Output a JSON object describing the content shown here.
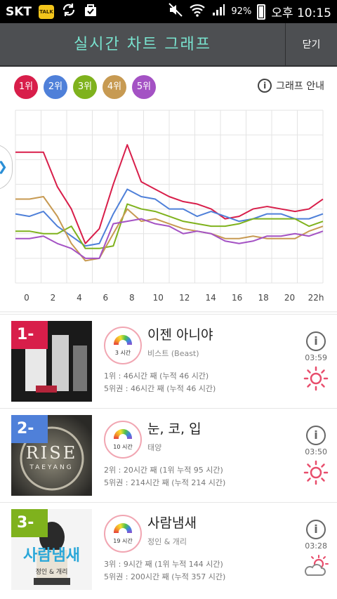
{
  "statusbar": {
    "carrier": "SKT",
    "talk": "TALK",
    "battery": "92%",
    "time": "오후 10:15"
  },
  "header": {
    "title": "실시간 차트 그래프",
    "close_label": "닫기"
  },
  "rank_buttons": [
    {
      "label": "1위",
      "color": "#d81e4a"
    },
    {
      "label": "2위",
      "color": "#4f80d9"
    },
    {
      "label": "3위",
      "color": "#7fb21d"
    },
    {
      "label": "4위",
      "color": "#c79a52"
    },
    {
      "label": "5위",
      "color": "#a452c4"
    }
  ],
  "guide_label": "그래프 안내",
  "chart_data": {
    "type": "line",
    "x": [
      0,
      1,
      2,
      3,
      4,
      5,
      6,
      7,
      8,
      9,
      10,
      11,
      12,
      13,
      14,
      15,
      16,
      17,
      18,
      19,
      20,
      21,
      22
    ],
    "tick_labels": [
      "0",
      "2",
      "4",
      "6",
      "8",
      "10",
      "12",
      "14",
      "16",
      "18",
      "20",
      "22h"
    ],
    "ylim": [
      0,
      7
    ],
    "grid": true,
    "series": [
      {
        "color": "#d81e4a",
        "values": [
          5.3,
          5.3,
          5.3,
          3.9,
          3.0,
          1.6,
          2.2,
          4.0,
          5.6,
          4.1,
          3.8,
          3.5,
          3.3,
          3.2,
          3.0,
          2.6,
          2.7,
          3.0,
          3.1,
          3.0,
          2.9,
          3.0,
          3.4
        ]
      },
      {
        "color": "#4f80d9",
        "values": [
          2.8,
          2.7,
          2.9,
          2.3,
          1.9,
          1.5,
          1.6,
          2.8,
          3.8,
          3.5,
          3.4,
          3.0,
          3.0,
          2.7,
          2.9,
          2.7,
          2.5,
          2.6,
          2.8,
          2.8,
          2.6,
          2.6,
          2.8
        ]
      },
      {
        "color": "#7fb21d",
        "values": [
          2.1,
          2.1,
          2.0,
          2.0,
          2.3,
          1.4,
          1.4,
          1.5,
          3.2,
          3.0,
          2.9,
          2.7,
          2.5,
          2.4,
          2.3,
          2.3,
          2.4,
          2.6,
          2.6,
          2.6,
          2.6,
          2.3,
          2.5
        ]
      },
      {
        "color": "#c79a52",
        "values": [
          3.4,
          3.4,
          3.5,
          2.7,
          1.6,
          0.9,
          1.0,
          2.0,
          3.0,
          2.5,
          2.6,
          2.4,
          2.2,
          2.1,
          2.0,
          1.8,
          1.8,
          1.9,
          1.8,
          1.8,
          1.8,
          2.1,
          2.3
        ]
      },
      {
        "color": "#a452c4",
        "values": [
          1.8,
          1.8,
          1.9,
          1.6,
          1.4,
          1.0,
          1.0,
          2.4,
          2.5,
          2.6,
          2.4,
          2.3,
          2.0,
          2.1,
          2.0,
          1.7,
          1.6,
          1.7,
          1.9,
          1.9,
          2.0,
          1.9,
          2.1
        ]
      }
    ]
  },
  "list": [
    {
      "rank": "1-",
      "rank_color": "#d81e4a",
      "weeks": "3 시간",
      "title": "이젠 아니야",
      "artist": "비스트 (Beast)",
      "stat1": "1위 : 46시간 째 (누적 46 시간)",
      "stat2": "5위권 : 46시간 째 (누적 46 시간)",
      "time": "03:59",
      "weather": "sun"
    },
    {
      "rank": "2-",
      "rank_color": "#4f80d9",
      "weeks": "10 시간",
      "title": "눈, 코, 입",
      "artist": "태양",
      "cover_text": "RISE",
      "cover_sub": "TAEYANG",
      "stat1": "2위 : 20시간 째 (1위 누적 95 시간)",
      "stat2": "5위권 : 214시간 째 (누적 214 시간)",
      "time": "03:50",
      "weather": "sun"
    },
    {
      "rank": "3-",
      "rank_color": "#7fb21d",
      "weeks": "19 시간",
      "title": "사람냄새",
      "artist": "정인 & 개리",
      "cover_text": "사람냄새",
      "cover_sub": "정인 & 개리",
      "stat1": "3위 : 9시간 째 (1위 누적 144 시간)",
      "stat2": "5위권 : 200시간 째 (누적 357 시간)",
      "time": "03:28",
      "weather": "partly-cloudy"
    }
  ]
}
